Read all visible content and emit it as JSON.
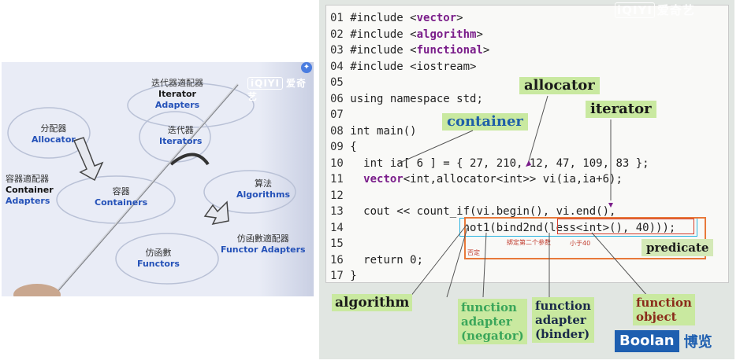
{
  "left_slide": {
    "iqiyi": "爱奇艺",
    "iqiyi_box": "iQIYI",
    "nodes": {
      "iterator_adapters": {
        "zh": "迭代器適配器",
        "en": "Iterator Adapters"
      },
      "allocator": {
        "zh": "分配器",
        "en": "Allocator"
      },
      "iterators": {
        "zh": "迭代器",
        "en": "Iterators"
      },
      "container_adapters": {
        "zh": "容器適配器",
        "en1": "Container",
        "en2": "Adapters"
      },
      "containers": {
        "zh": "容器",
        "en": "Containers"
      },
      "algorithms": {
        "zh": "算法",
        "en": "Algorithms"
      },
      "functors": {
        "zh": "仿函數",
        "en": "Functors"
      },
      "functor_adapters": {
        "zh": "仿函數適配器",
        "en": "Functor Adapters"
      }
    }
  },
  "right_slide": {
    "iqiyi": "爱奇艺",
    "code": [
      {
        "n": "01",
        "a": "#include <",
        "kw": "vector",
        "b": ">"
      },
      {
        "n": "02",
        "a": "#include <",
        "kw": "algorithm",
        "b": ">"
      },
      {
        "n": "03",
        "a": "#include <",
        "kw": "functional",
        "b": ">"
      },
      {
        "n": "04",
        "a": "#include <iostream>",
        "kw": "",
        "b": ""
      },
      {
        "n": "05",
        "a": "",
        "kw": "",
        "b": ""
      },
      {
        "n": "06",
        "a": "using namespace std;",
        "kw": "",
        "b": ""
      },
      {
        "n": "07",
        "a": "",
        "kw": "",
        "b": ""
      },
      {
        "n": "08",
        "a": "int main()",
        "kw": "",
        "b": ""
      },
      {
        "n": "09",
        "a": "{",
        "kw": "",
        "b": ""
      },
      {
        "n": "10",
        "a": "  int ia[ 6 ] = { 27, 210, 12, 47, 109, 83 };",
        "kw": "",
        "b": ""
      },
      {
        "n": "11",
        "a": "  ",
        "kw": "vector",
        "b": "<int,allocator<int>> vi(ia,ia+6);"
      },
      {
        "n": "12",
        "a": "",
        "kw": "",
        "b": ""
      },
      {
        "n": "13",
        "a": "  cout << count_if(vi.begin(), vi.end(),",
        "kw": "",
        "b": ""
      },
      {
        "n": "14",
        "a": "                 not1(bind2nd(less<int>(), 40)));",
        "kw": "",
        "b": ""
      },
      {
        "n": "15",
        "a": "",
        "kw": "",
        "b": ""
      },
      {
        "n": "16",
        "a": "  return 0;",
        "kw": "",
        "b": ""
      },
      {
        "n": "17",
        "a": "}",
        "kw": "",
        "b": ""
      }
    ],
    "tags": {
      "allocator": "allocator",
      "iterator": "iterator",
      "container": "container",
      "predicate": "predicate"
    },
    "notes": {
      "negate": "否定",
      "bind_second": "綁定第二个参数",
      "less_than_40": "小于40"
    },
    "lower_labels": {
      "algorithm": "algorithm",
      "function_adapter_negator": [
        "function",
        "adapter",
        "(negator)"
      ],
      "function_adapter_binder": [
        "function",
        "adapter",
        "(binder)"
      ],
      "function_object": [
        "function",
        "object"
      ]
    },
    "brand": {
      "boolan": "Boolan",
      "bolan_zh": "博览"
    }
  }
}
